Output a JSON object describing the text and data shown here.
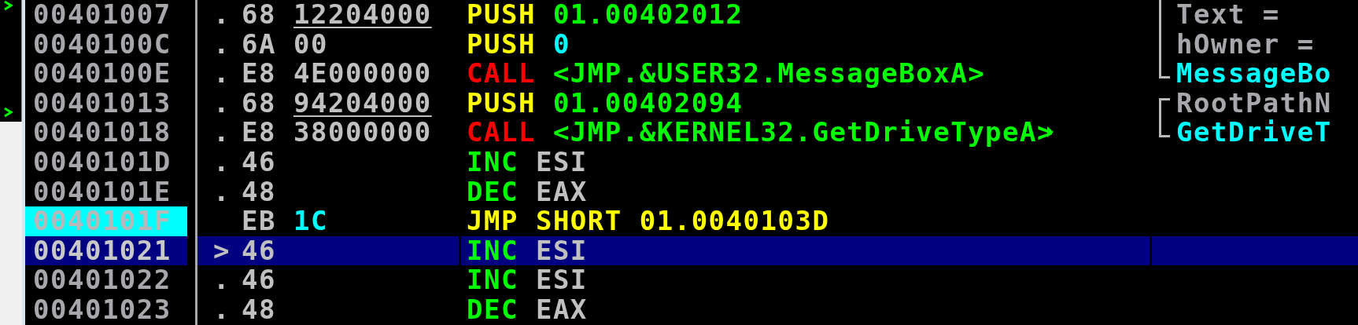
{
  "rows": [
    {
      "address": "00401007",
      "marker": ".",
      "opcode": "68",
      "arg": {
        "text": "12204000",
        "kind": "address"
      },
      "mnemonic": {
        "text": "PUSH",
        "kind": "push"
      },
      "operand": {
        "text": "01.00402012",
        "kind": "address"
      },
      "selected": false,
      "jump_target": false,
      "comment": {
        "text": "Text =",
        "kind": "arg",
        "bracket": {
          "kind": "mid"
        }
      }
    },
    {
      "address": "0040100C",
      "marker": ".",
      "opcode": "6A",
      "arg": {
        "text": "00",
        "kind": "plain"
      },
      "mnemonic": {
        "text": "PUSH",
        "kind": "push"
      },
      "operand": {
        "text": "0",
        "kind": "immediate"
      },
      "selected": false,
      "jump_target": false,
      "comment": {
        "text": "hOwner =",
        "kind": "arg",
        "bracket": {
          "kind": "mid"
        }
      }
    },
    {
      "address": "0040100E",
      "marker": ".",
      "opcode": "E8",
      "arg": {
        "text": "4E000000",
        "kind": "plain"
      },
      "mnemonic": {
        "text": "CALL",
        "kind": "call"
      },
      "operand": {
        "text": "<JMP.&USER32.MessageBoxA>",
        "kind": "address"
      },
      "selected": false,
      "jump_target": false,
      "comment": {
        "text": "MessageBo",
        "kind": "api",
        "bracket": {
          "kind": "end"
        }
      }
    },
    {
      "address": "00401013",
      "marker": ".",
      "opcode": "68",
      "arg": {
        "text": "94204000",
        "kind": "address"
      },
      "mnemonic": {
        "text": "PUSH",
        "kind": "push"
      },
      "operand": {
        "text": "01.00402094",
        "kind": "address"
      },
      "selected": false,
      "jump_target": false,
      "comment": {
        "text": "RootPathN",
        "kind": "arg",
        "bracket": {
          "kind": "start"
        }
      }
    },
    {
      "address": "00401018",
      "marker": ".",
      "opcode": "E8",
      "arg": {
        "text": "38000000",
        "kind": "plain"
      },
      "mnemonic": {
        "text": "CALL",
        "kind": "call"
      },
      "operand": {
        "text": "<JMP.&KERNEL32.GetDriveTypeA>",
        "kind": "address"
      },
      "selected": false,
      "jump_target": false,
      "jump_arrow": true,
      "comment": {
        "text": "GetDriveT",
        "kind": "api",
        "bracket": {
          "kind": "end"
        }
      }
    },
    {
      "address": "0040101D",
      "marker": ".",
      "opcode": "46",
      "mnemonic": {
        "text": "INC",
        "kind": "arith"
      },
      "operand": {
        "text": "ESI",
        "kind": "register"
      },
      "selected": false,
      "jump_target": false
    },
    {
      "address": "0040101E",
      "marker": ".",
      "opcode": "48",
      "mnemonic": {
        "text": "DEC",
        "kind": "arith"
      },
      "operand": {
        "text": "EAX",
        "kind": "register"
      },
      "selected": false,
      "jump_target": false
    },
    {
      "address": "0040101F",
      "opcode": "EB",
      "arg": {
        "text": "1C",
        "kind": "immediate"
      },
      "mnemonic": {
        "text": "JMP",
        "kind": "jump"
      },
      "operand": {
        "text": "SHORT 01.0040103D",
        "kind": "jump"
      },
      "selected": false,
      "jump_target": true
    },
    {
      "address": "00401021",
      "marker": ">",
      "opcode": "46",
      "mnemonic": {
        "text": "INC",
        "kind": "arith"
      },
      "operand": {
        "text": "ESI",
        "kind": "register"
      },
      "selected": true,
      "jump_target": false
    },
    {
      "address": "00401022",
      "marker": ".",
      "opcode": "46",
      "mnemonic": {
        "text": "INC",
        "kind": "arith"
      },
      "operand": {
        "text": "ESI",
        "kind": "register"
      },
      "selected": false,
      "jump_target": false
    },
    {
      "address": "00401023",
      "marker": ".",
      "opcode": "48",
      "mnemonic": {
        "text": "DEC",
        "kind": "arith"
      },
      "operand": {
        "text": "EAX",
        "kind": "register"
      },
      "selected": false,
      "jump_target": false
    }
  ]
}
